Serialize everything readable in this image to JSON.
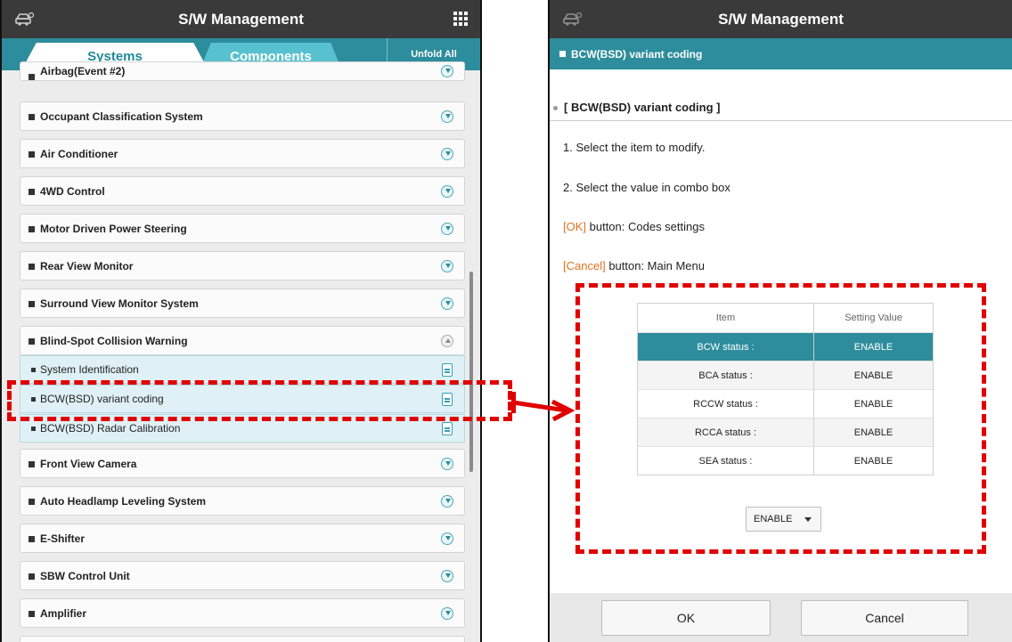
{
  "left": {
    "title": "S/W Management",
    "tabs": {
      "systems": "Systems",
      "components": "Components",
      "unfold_all": "Unfold All"
    },
    "items": [
      "Airbag(Event #2)",
      "Occupant Classification System",
      "Air Conditioner",
      "4WD Control",
      "Motor Driven Power Steering",
      "Rear View Monitor",
      "Surround View Monitor System",
      "Blind-Spot Collision Warning"
    ],
    "sub_items": [
      "System Identification",
      "BCW(BSD) variant coding",
      "BCW(BSD) Radar Calibration"
    ],
    "items_after": [
      "Front View Camera",
      "Auto Headlamp Leveling System",
      "E-Shifter",
      "SBW Control Unit",
      "Amplifier"
    ]
  },
  "right": {
    "title": "S/W Management",
    "subbar": "BCW(BSD) variant coding",
    "section": "[ BCW(BSD) variant coding ]",
    "step1": "1. Select the item to modify.",
    "step2": "2. Select the value in combo box",
    "ok_hl": "[OK]",
    "ok_text": " button: Codes settings",
    "cancel_hl": "[Cancel]",
    "cancel_text": " button: Main Menu",
    "table": {
      "headers": [
        "Item",
        "Setting Value"
      ],
      "rows": [
        [
          "BCW status :",
          "ENABLE"
        ],
        [
          "BCA status :",
          "ENABLE"
        ],
        [
          "RCCW status :",
          "ENABLE"
        ],
        [
          "RCCA status :",
          "ENABLE"
        ],
        [
          "SEA status :",
          "ENABLE"
        ]
      ]
    },
    "combo_value": "ENABLE",
    "ok_button": "OK",
    "cancel_button": "Cancel"
  },
  "colors": {
    "teal": "#2d8d9c",
    "highlight": "#e00000",
    "orange": "#e0731f"
  }
}
